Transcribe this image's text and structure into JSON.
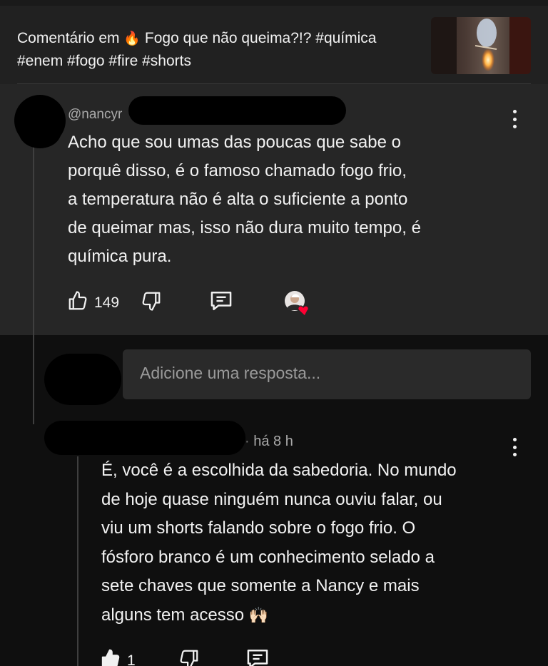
{
  "header": {
    "title_prefix": "Comentário em",
    "title_emoji": "🔥",
    "title_rest": "Fogo que não queima?!? #química #enem #fogo #fire #shorts"
  },
  "comment": {
    "handle": "@nancyr",
    "text_lines": [
      "Acho que sou umas das poucas que sabe o",
      "porquê disso, é o famoso chamado fogo frio,",
      "a temperatura não é alta o suficiente a ponto",
      "de queimar mas, isso não dura muito tempo, é",
      "química pura."
    ],
    "likes": "149",
    "icons": [
      "thumbs-up-icon",
      "thumbs-down-icon",
      "reply-icon",
      "creator-heart-icon",
      "more-vert-icon"
    ]
  },
  "reply_input": {
    "placeholder": "Adicione uma resposta..."
  },
  "reply": {
    "timestamp": "há 8 h",
    "text_lines": [
      "É, você é a escolhida da sabedoria. No mundo",
      "de hoje quase ninguém nunca ouviu falar, ou",
      "viu um shorts falando sobre o fogo frio. O",
      "fósforo branco é um conhecimento selado a",
      "sete chaves que somente a Nancy e mais",
      "alguns tem acesso"
    ],
    "hands_emoji": "🙌🏻",
    "likes": "1"
  },
  "colors": {
    "background": "#0f0f0f",
    "header_bg": "#212121",
    "comment_bg": "#262626",
    "input_bg": "#2a2a2a",
    "text": "#f1f1f1",
    "muted": "#aaaaaa",
    "heart": "#ff0033"
  }
}
